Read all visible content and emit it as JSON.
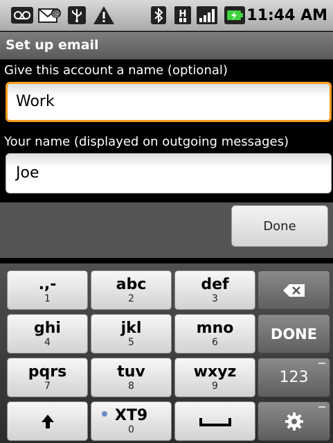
{
  "status_bar": {
    "time": "11:44 AM",
    "icons": [
      "voicemail-icon",
      "email-notification-icon",
      "usb-icon",
      "warning-icon",
      "bluetooth-icon",
      "hsdpa-icon",
      "signal-icon",
      "battery-icon"
    ],
    "network_badge": "H"
  },
  "title_bar": {
    "title": "Set up email"
  },
  "form": {
    "account_name_label": "Give this account a name (optional)",
    "account_name_value": "Work",
    "your_name_label": "Your name (displayed on outgoing messages)",
    "your_name_value": "Joe"
  },
  "done_button": {
    "label": "Done"
  },
  "keyboard": {
    "row1": [
      {
        "main": ".,-",
        "sub": "1"
      },
      {
        "main": "abc",
        "sub": "2"
      },
      {
        "main": "def",
        "sub": "3"
      }
    ],
    "row2": [
      {
        "main": "ghi",
        "sub": "4"
      },
      {
        "main": "jkl",
        "sub": "5"
      },
      {
        "main": "mno",
        "sub": "6"
      }
    ],
    "row3": [
      {
        "main": "pqrs",
        "sub": "7"
      },
      {
        "main": "tuv",
        "sub": "8"
      },
      {
        "main": "wxyz",
        "sub": "9"
      }
    ],
    "row4": {
      "xt9": "XT9",
      "xt9_sub": "0"
    },
    "done_key": "DONE",
    "num_key": "123"
  }
}
